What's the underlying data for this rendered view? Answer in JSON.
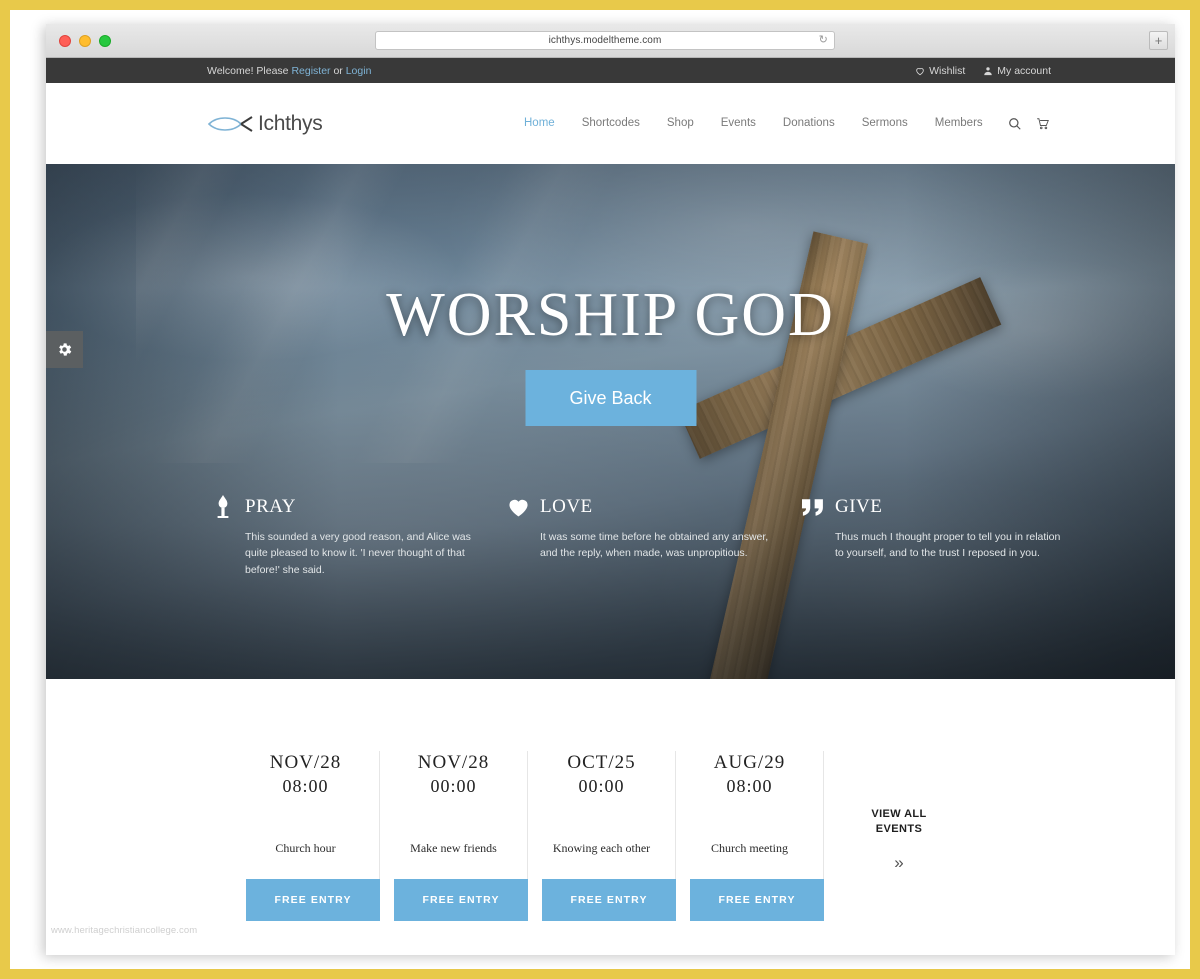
{
  "browser": {
    "url": "ichthys.modeltheme.com",
    "reload_icon": "reload-icon",
    "newtab_label": "+"
  },
  "topbar": {
    "welcome_prefix": "Welcome! Please ",
    "register_label": "Register",
    "or_label": " or ",
    "login_label": "Login",
    "wishlist_label": "Wishlist",
    "account_label": "My account"
  },
  "header": {
    "logo_text": "Ichthys",
    "nav": [
      {
        "label": "Home",
        "active": true
      },
      {
        "label": "Shortcodes",
        "active": false
      },
      {
        "label": "Shop",
        "active": false
      },
      {
        "label": "Events",
        "active": false
      },
      {
        "label": "Donations",
        "active": false
      },
      {
        "label": "Sermons",
        "active": false
      },
      {
        "label": "Members",
        "active": false
      }
    ],
    "search_icon": "search-icon",
    "cart_icon": "cart-icon"
  },
  "hero": {
    "title": "WORSHIP GOD",
    "cta_label": "Give Back",
    "settings_icon": "gear-icon",
    "features": [
      {
        "icon": "candle-icon",
        "title": "PRAY",
        "text": "This sounded a very good reason, and Alice was quite pleased to know it. 'I never thought of that before!' she said."
      },
      {
        "icon": "heart-icon",
        "title": "LOVE",
        "text": "It was some time before he obtained any answer, and the reply, when made, was unpropitious."
      },
      {
        "icon": "quote-icon",
        "title": "GIVE",
        "text": "Thus much I thought proper to tell you in relation to yourself, and to the trust I reposed in you."
      }
    ]
  },
  "events": {
    "items": [
      {
        "date": "NOV/28",
        "time": "08:00",
        "title": "Church hour",
        "button": "FREE ENTRY"
      },
      {
        "date": "NOV/28",
        "time": "00:00",
        "title": "Make new friends",
        "button": "FREE ENTRY"
      },
      {
        "date": "OCT/25",
        "time": "00:00",
        "title": "Knowing each other",
        "button": "FREE ENTRY"
      },
      {
        "date": "AUG/29",
        "time": "08:00",
        "title": "Church meeting",
        "button": "FREE ENTRY"
      }
    ],
    "view_all_line1": "VIEW ALL",
    "view_all_line2": "EVENTS",
    "view_all_arrow": "»"
  },
  "watermark": "www.heritagechristiancollege.com",
  "colors": {
    "accent_blue": "#6cb2dd",
    "topbar_dark": "#393939",
    "frame_gold": "#e8c94a"
  }
}
